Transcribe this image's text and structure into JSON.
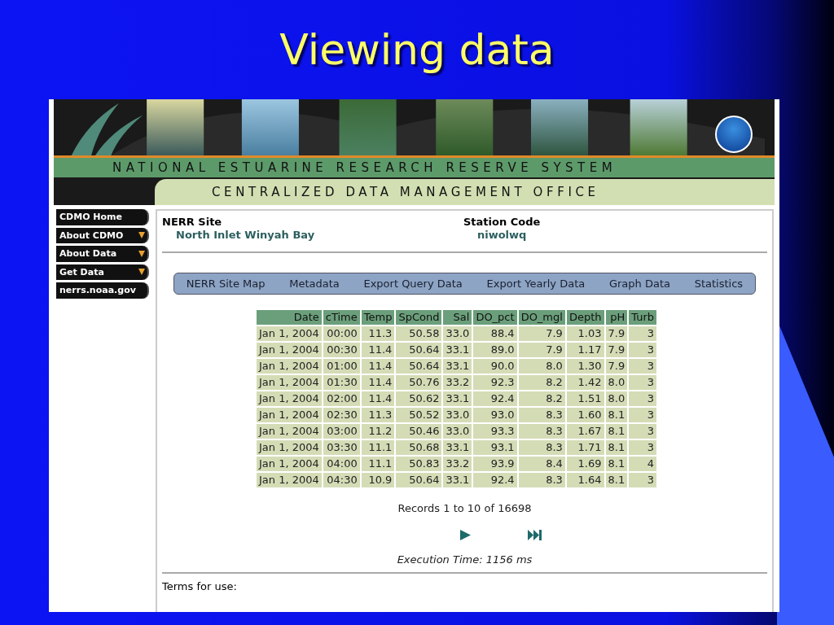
{
  "slide": {
    "title": "Viewing data"
  },
  "banner": {
    "line_1": "NATIONAL ESTUARINE RESEARCH RESERVE SYSTEM",
    "line_2": "CENTRALIZED DATA MANAGEMENT OFFICE"
  },
  "sidebar": {
    "items": [
      {
        "label": "CDMO Home",
        "has_menu": false
      },
      {
        "label": "About CDMO",
        "has_menu": true
      },
      {
        "label": "About Data",
        "has_menu": true
      },
      {
        "label": "Get Data",
        "has_menu": true
      },
      {
        "label": "nerrs.noaa.gov",
        "has_menu": false
      }
    ]
  },
  "site": {
    "nerr_site_label": "NERR Site",
    "nerr_site": "North Inlet Winyah Bay",
    "station_code_label": "Station Code",
    "station_code": "niwolwq"
  },
  "nav": [
    "NERR Site Map",
    "Metadata",
    "Export Query Data",
    "Export Yearly Data",
    "Graph Data",
    "Statistics"
  ],
  "table": {
    "columns": [
      "Date",
      "cTime",
      "Temp",
      "SpCond",
      "Sal",
      "DO_pct",
      "DO_mgl",
      "Depth",
      "pH",
      "Turb"
    ],
    "rows": [
      [
        "Jan 1, 2004",
        "00:00",
        "11.3",
        "50.58",
        "33.0",
        "88.4",
        "7.9",
        "1.03",
        "7.9",
        "3"
      ],
      [
        "Jan 1, 2004",
        "00:30",
        "11.4",
        "50.64",
        "33.1",
        "89.0",
        "7.9",
        "1.17",
        "7.9",
        "3"
      ],
      [
        "Jan 1, 2004",
        "01:00",
        "11.4",
        "50.64",
        "33.1",
        "90.0",
        "8.0",
        "1.30",
        "7.9",
        "3"
      ],
      [
        "Jan 1, 2004",
        "01:30",
        "11.4",
        "50.76",
        "33.2",
        "92.3",
        "8.2",
        "1.42",
        "8.0",
        "3"
      ],
      [
        "Jan 1, 2004",
        "02:00",
        "11.4",
        "50.62",
        "33.1",
        "92.4",
        "8.2",
        "1.51",
        "8.0",
        "3"
      ],
      [
        "Jan 1, 2004",
        "02:30",
        "11.3",
        "50.52",
        "33.0",
        "93.0",
        "8.3",
        "1.60",
        "8.1",
        "3"
      ],
      [
        "Jan 1, 2004",
        "03:00",
        "11.2",
        "50.46",
        "33.0",
        "93.3",
        "8.3",
        "1.67",
        "8.1",
        "3"
      ],
      [
        "Jan 1, 2004",
        "03:30",
        "11.1",
        "50.68",
        "33.1",
        "93.1",
        "8.3",
        "1.71",
        "8.1",
        "3"
      ],
      [
        "Jan 1, 2004",
        "04:00",
        "11.1",
        "50.83",
        "33.2",
        "93.9",
        "8.4",
        "1.69",
        "8.1",
        "4"
      ],
      [
        "Jan 1, 2004",
        "04:30",
        "10.9",
        "50.64",
        "33.1",
        "92.4",
        "8.3",
        "1.64",
        "8.1",
        "3"
      ]
    ]
  },
  "records": "Records 1 to 10 of 16698",
  "execution_time": "Execution Time: 1156 ms",
  "terms": "Terms for use:"
}
